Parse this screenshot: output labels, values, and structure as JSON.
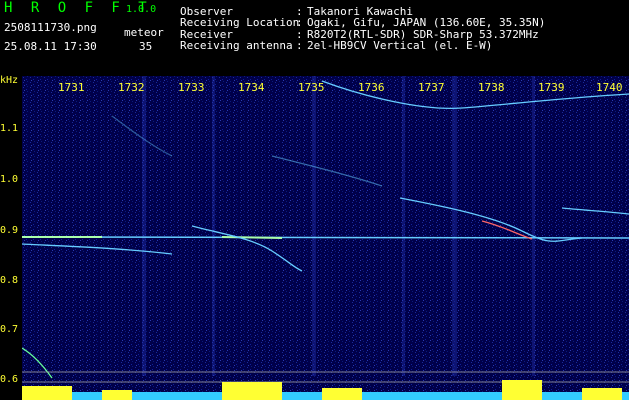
{
  "app": {
    "name": "H R O F F T",
    "version": "1.0.0",
    "filename": "2508111730.png",
    "datetime": "25.08.11 17:30",
    "counter_label": "meteor",
    "counter_value": "35"
  },
  "info": [
    {
      "label": "Observer",
      "value": "Takanori Kawachi"
    },
    {
      "label": "Receiving Location",
      "value": "Ogaki, Gifu, JAPAN (136.60E, 35.35N)"
    },
    {
      "label": "Receiver",
      "value": "R820T2(RTL-SDR) SDR-Sharp 53.372MHz"
    },
    {
      "label": "Receiving antenna",
      "value": "2el-HB9CV Vertical (el. E-W)"
    }
  ],
  "axis": {
    "y_unit": "kHz",
    "x_ticks": [
      "1731",
      "1732",
      "1733",
      "1734",
      "1735",
      "1736",
      "1737",
      "1738",
      "1739",
      "1740"
    ],
    "y_ticks": [
      "1.1",
      "1.0",
      "0.9",
      "0.8",
      "0.7",
      "0.6"
    ]
  },
  "colors": {
    "header_text": "#ffffff",
    "accent": "#00ff00",
    "tick": "#ffff33",
    "background": "#000044",
    "signal": "#66ccff"
  }
}
